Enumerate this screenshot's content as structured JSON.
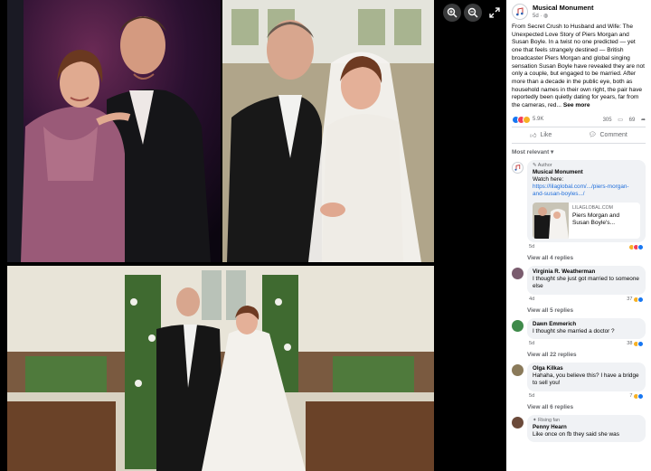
{
  "viewer": {
    "icons": [
      "zoom-in-icon",
      "zoom-out-icon",
      "expand-icon"
    ]
  },
  "post": {
    "page_name": "Musical Monument",
    "meta": "5d · ",
    "body": "From Secret Crush to Husband and Wife: The Unexpected Love Story of Piers Morgan and Susan Boyle. In a twist no one predicted — yet one that feels strangely destined — British broadcaster Piers Morgan and global singing sensation Susan Boyle have revealed they are not only a couple, but engaged to be married. After more than a decade in the public eye, both as household names in their own right, the pair have reportedly been quietly dating for years, far from the cameras, red...",
    "see_more": "See more",
    "reaction_count": "5.9K",
    "comment_count": "305",
    "share_count": "69",
    "like_label": "Like",
    "comment_label": "Comment",
    "most_relevant": "Most relevant"
  },
  "comments": [
    {
      "tag": "Author",
      "name": "Musical Monument",
      "text": "Watch here:",
      "link": "https://lilaglobal.com/.../piers-morgan-and-susan-boyles.../",
      "card_domain": "LILAGLOBAL.COM",
      "card_title": "Piers Morgan and Susan Boyle's...",
      "time": "5d",
      "replies": "View all 4 replies",
      "avatar_color": "#ffffff"
    },
    {
      "name": "Virginia R. Weatherman",
      "text": "I thought she just got married to someone else",
      "time": "4d",
      "count": "37",
      "replies": "View all 5 replies",
      "avatar_color": "#7a5c6e"
    },
    {
      "name": "Dawn Emmerich",
      "text": "I thought she married a doctor ?",
      "time": "5d",
      "count": "38",
      "replies": "View all 22 replies",
      "avatar_color": "#3f8a4a"
    },
    {
      "name": "Olga Kilkas",
      "text": "Hahaha, you believe this? I have a bridge to sell you!",
      "time": "5d",
      "count": "7",
      "replies": "View all 6 replies",
      "avatar_color": "#8a7a5a"
    },
    {
      "tag": "Rising fan",
      "name": "Penny Hearn",
      "text": "Like once on fb they said she was",
      "avatar_color": "#6b4a3a"
    }
  ],
  "colors": {
    "like_blue": "#1877f2",
    "love_red": "#f33e58",
    "care_yellow": "#f7b125",
    "link_blue": "#216fdb"
  }
}
